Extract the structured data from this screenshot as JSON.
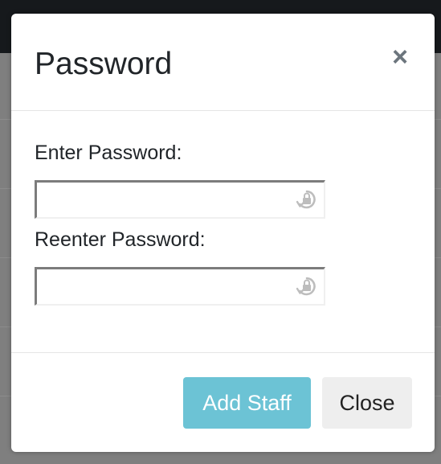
{
  "modal": {
    "title": "Password",
    "close_symbol": "×"
  },
  "fields": [
    {
      "label": "Enter Password:",
      "value": "",
      "icon": "lock-refresh-icon"
    },
    {
      "label": "Reenter Password:",
      "value": "",
      "icon": "lock-refresh-icon"
    }
  ],
  "footer": {
    "add_label": "Add Staff",
    "close_label": "Close"
  },
  "colors": {
    "primary_button": "#6cc3d5",
    "secondary_button": "#eeeeee",
    "backdrop": "#7f7f7f",
    "topbar": "#16191c"
  }
}
